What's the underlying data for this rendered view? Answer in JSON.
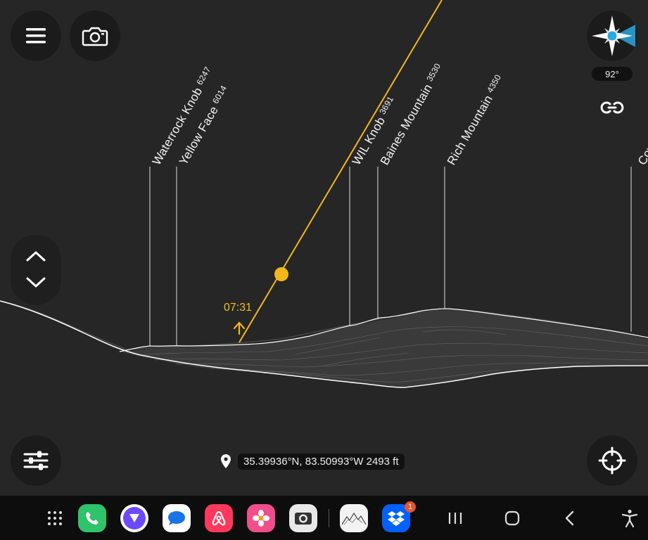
{
  "heading": "92°",
  "peaks": [
    {
      "name": "Waterrock Knob",
      "elevation": "6247"
    },
    {
      "name": "Yellow Face",
      "elevation": "6014"
    },
    {
      "name": "WIL Knob",
      "elevation": "3691"
    },
    {
      "name": "Baines Mountain",
      "elevation": "3530"
    },
    {
      "name": "Rich Mountain",
      "elevation": "4350"
    },
    {
      "name": "Cow",
      "elevation": ""
    }
  ],
  "sun": {
    "time": "07:31"
  },
  "location": {
    "coords": "35.39936°N, 83.50993°W 2493 ft"
  },
  "icons": {
    "menu": "hamburger-menu-icon",
    "camera": "camera-icon",
    "compass": "compass-icon",
    "link": "link-icon",
    "up": "chevron-up-icon",
    "down": "chevron-down-icon",
    "settings": "sliders-icon",
    "locate": "crosshair-icon",
    "pin": "location-pin-icon"
  },
  "taskbar": {
    "badge": "1",
    "apps": [
      "app-drawer",
      "phone",
      "proton-vpn",
      "messages",
      "airbnb",
      "photos",
      "camera",
      "peakvisor",
      "dropbox"
    ]
  },
  "colors": {
    "sun_path": "#f2b71a",
    "background": "#262626",
    "ridge": "#ffffff"
  }
}
